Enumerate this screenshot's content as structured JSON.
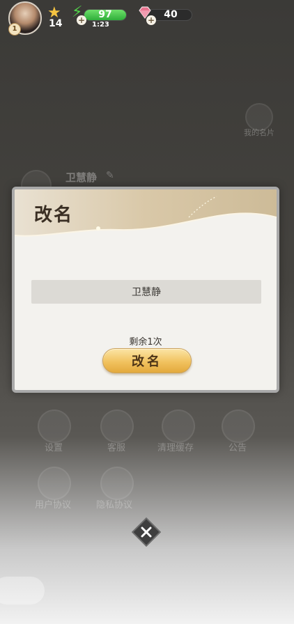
{
  "status_bar": {
    "player_level": "1",
    "stars": "14",
    "energy": {
      "value": "97",
      "timer": "1:23",
      "fill_fraction": 1.0
    },
    "gems": "40"
  },
  "background": {
    "player_name": "卫慧静",
    "my_card": "我的名片",
    "menu": [
      "设置",
      "客服",
      "清理缓存",
      "公告",
      "用户协议",
      "隐私协议"
    ]
  },
  "dialog": {
    "title": "改名",
    "name_value": "卫慧静",
    "remaining": "剩余1次",
    "button_label": "改名"
  },
  "icons": {
    "close": "close-icon",
    "star": "star-icon",
    "energy": "bolt-icon",
    "gem": "gem-icon"
  },
  "colors": {
    "button_gold": "#f1c25f",
    "energy_green": "#3fc04a",
    "star_gold": "#f6c442",
    "gem_pink": "#e8738f"
  }
}
